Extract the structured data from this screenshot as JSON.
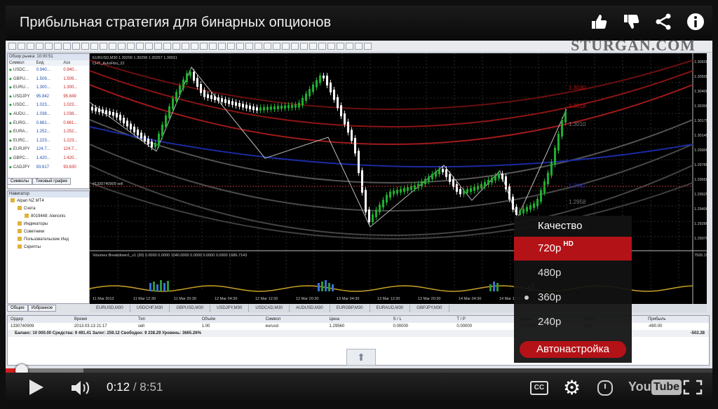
{
  "video": {
    "title": "Прибыльная стратегия для бинарных опционов",
    "watermark": "STURGAN.COM"
  },
  "market_watch": {
    "header": "Обзор рынка: 10:00:51",
    "columns": [
      "Символ",
      "Бид",
      "Аск"
    ],
    "rows": [
      {
        "symbol": "USDC...",
        "bid": "0.940...",
        "ask": "0.940..."
      },
      {
        "symbol": "GBPU...",
        "bid": "1.509...",
        "ask": "1.509..."
      },
      {
        "symbol": "EURU...",
        "bid": "1.300...",
        "ask": "1.300..."
      },
      {
        "symbol": "USDJPY",
        "bid": "95.842",
        "ask": "95.849"
      },
      {
        "symbol": "USDC...",
        "bid": "1.023...",
        "ask": "1.023..."
      },
      {
        "symbol": "AUDU...",
        "bid": "1.038...",
        "ask": "1.038..."
      },
      {
        "symbol": "EURG...",
        "bid": "0.861...",
        "ask": "0.861..."
      },
      {
        "symbol": "EURA...",
        "bid": "1.252...",
        "ask": "1.252..."
      },
      {
        "symbol": "EURC...",
        "bid": "1.223...",
        "ask": "1.223..."
      },
      {
        "symbol": "EURJPY",
        "bid": "124.7...",
        "ask": "124.7..."
      },
      {
        "symbol": "GBPC...",
        "bid": "1.420...",
        "ask": "1.420..."
      },
      {
        "symbol": "CADJPY",
        "bid": "93.617",
        "ask": "93.630"
      }
    ],
    "tabs": [
      "Символы",
      "Тиковый график"
    ]
  },
  "navigator": {
    "header": "Навигатор",
    "items": [
      {
        "label": "Alpari NZ MT4",
        "level": 0
      },
      {
        "label": "Счета",
        "level": 1
      },
      {
        "label": "8019448: Alenonis",
        "level": 2
      },
      {
        "label": "Индикаторы",
        "level": 1
      },
      {
        "label": "Советники",
        "level": 1
      },
      {
        "label": "Пользовательские Инд",
        "level": 1
      },
      {
        "label": "Скрипты",
        "level": 1
      }
    ],
    "tabs": [
      "Общие",
      "Избранное"
    ]
  },
  "chart": {
    "header": "EURUSD,M30  1.30299 1.30299 1.30257 1.30011",
    "indicator_label": "CHT_AutoFibo_22",
    "order_label": "#1330740909 sell",
    "sub_header": "Volumes Breakdown1_v1 (30)  0.0000 0.0000 1040.0000 0.0000 0.0000 0.0000 1686.7143",
    "price_ticks": [
      "1.30600",
      "1.30500",
      "1.30400",
      "1.30300",
      "1.30175",
      "1.30145",
      "1.29900",
      "1.29780",
      "1.29650",
      "1.29525",
      "1.29400",
      "1.29280",
      "1.29070"
    ],
    "vol_tick": "7926.15",
    "time_ticks": [
      "11 Mar 2013",
      "11 Mar 12:30",
      "11 Mar 20:30",
      "12 Mar 04:30",
      "12 Mar 12:30",
      "12 Mar 20:30",
      "13 Mar 04:30",
      "13 Mar 12:30",
      "13 Mar 20:30",
      "14 Mar 04:30",
      "14 Mar 12:30",
      "14 Mar 20:30"
    ],
    "fib_labels": [
      "1.3030",
      "1.3018",
      "1.3010",
      "1.2982",
      "1.2958",
      "1.2940"
    ]
  },
  "symbol_tabs": [
    "EURUSD,M30",
    "USDCHF,M30",
    "GBPUSD,M30",
    "USDJPY,M30",
    "USDCAD,M30",
    "AUDUSD,M30",
    "EURGBP,M30",
    "EURAUD,M30",
    "GBPJPY,M30"
  ],
  "terminal": {
    "columns": [
      "Ордер",
      "Время",
      "Тип",
      "Объём",
      "Символ",
      "Цена",
      "S / L",
      "T / P",
      "Цена",
      "Своп",
      "Прибыль"
    ],
    "row": [
      "1330740909",
      "2013.03.13 21:17",
      "sell",
      "1.00",
      "eurusd",
      "1.29560",
      "0.00000",
      "0.00000",
      "1.30050",
      "-",
      "-"
    ],
    "row_swap": "0.33",
    "row_profit": "-490.00",
    "balance": "Баланс: 10 000.00  Средства: 9 491.41  Залог: 259.12  Свободно: 9 238.29  Уровень: 3665.26%",
    "balance_profit": "-502.28"
  },
  "quality_menu": {
    "title": "Качество",
    "options": [
      {
        "label": "720p",
        "badge": "HD"
      },
      {
        "label": "480p"
      },
      {
        "label": "360p"
      },
      {
        "label": "240p"
      }
    ],
    "auto_label": "Автонастройка",
    "selected_label": "720p",
    "current_label": "360p"
  },
  "player": {
    "current_time": "0:12",
    "separator": "/",
    "duration": "8:51",
    "played_fraction": 0.0226,
    "buffered_fraction": 0.11,
    "logo_you": "You",
    "logo_tube": "Tube",
    "cc_label": "CC"
  },
  "colors": {
    "accent": "#b31217",
    "progress_played": "#d21f1f",
    "candle_up": "#1fae2f",
    "candle_down": "#ffffff"
  }
}
